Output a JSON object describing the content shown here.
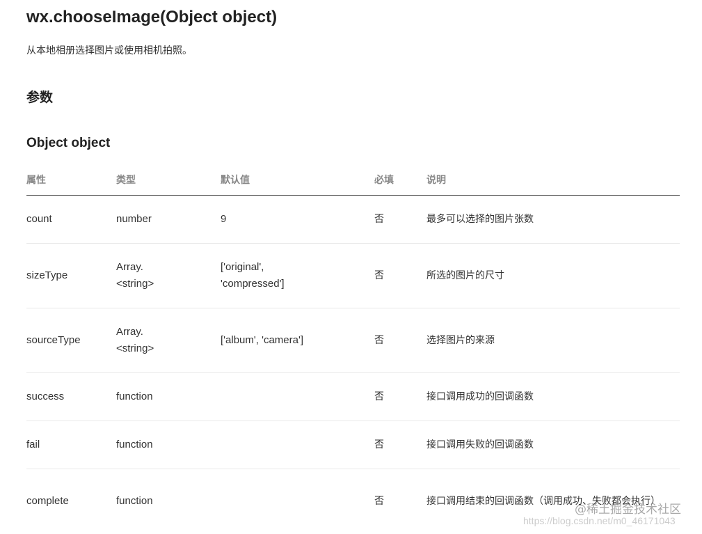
{
  "doc": {
    "api_title": "wx.chooseImage(Object object)",
    "description": "从本地相册选择图片或使用相机拍照。",
    "section_title": "参数",
    "object_title": "Object object"
  },
  "table": {
    "headers": {
      "name": "属性",
      "type": "类型",
      "default": "默认值",
      "required": "必填",
      "desc": "说明"
    },
    "rows": [
      {
        "name": "count",
        "type": "number",
        "default": "9",
        "required": "否",
        "desc": "最多可以选择的图片张数"
      },
      {
        "name": "sizeType",
        "type": "Array.<string>",
        "default": "['original', 'compressed']",
        "required": "否",
        "desc": "所选的图片的尺寸"
      },
      {
        "name": "sourceType",
        "type": "Array.<string>",
        "default": "['album', 'camera']",
        "required": "否",
        "desc": "选择图片的来源"
      },
      {
        "name": "success",
        "type": "function",
        "default": "",
        "required": "否",
        "desc": "接口调用成功的回调函数"
      },
      {
        "name": "fail",
        "type": "function",
        "default": "",
        "required": "否",
        "desc": "接口调用失败的回调函数"
      },
      {
        "name": "complete",
        "type": "function",
        "default": "",
        "required": "否",
        "desc": "接口调用结束的回调函数（调用成功、失败都会执行）"
      }
    ]
  },
  "watermark": {
    "brand": "@稀土掘金技术社区",
    "url": "https://blog.csdn.net/m0_46171043"
  }
}
